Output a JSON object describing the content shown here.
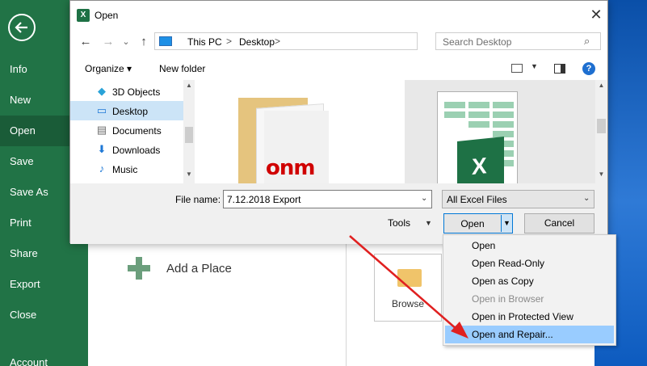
{
  "backstage": {
    "items": [
      {
        "label": "Info"
      },
      {
        "label": "New"
      },
      {
        "label": "Open"
      },
      {
        "label": "Save"
      },
      {
        "label": "Save As"
      },
      {
        "label": "Print"
      },
      {
        "label": "Share"
      },
      {
        "label": "Export"
      },
      {
        "label": "Close"
      },
      {
        "label": "Account"
      }
    ],
    "active": "Open",
    "colors": {
      "sidebar": "#217346",
      "active": "#1a5c38"
    }
  },
  "places": {
    "add_place_label": "Add a Place",
    "browse_label": "Browse"
  },
  "dialog": {
    "title": "Open",
    "close_glyph": "✕",
    "nav": {
      "back": "←",
      "forward": "→",
      "recent": "⌄",
      "up": "↑"
    },
    "address": {
      "segments": [
        "This PC",
        "Desktop"
      ],
      "separator": ">",
      "dropdown": "⌄",
      "refresh": "↻"
    },
    "search": {
      "placeholder": "Search Desktop",
      "icon": "⌕"
    },
    "toolbar": {
      "organize": "Organize ▾",
      "new_folder": "New folder",
      "view_dropdown": "▼",
      "help": "?"
    },
    "tree": [
      {
        "label": "3D Objects",
        "icon": "cube-icon",
        "glyph": "◆"
      },
      {
        "label": "Desktop",
        "icon": "desktop-icon",
        "glyph": "▭"
      },
      {
        "label": "Documents",
        "icon": "documents-icon",
        "glyph": "▤"
      },
      {
        "label": "Downloads",
        "icon": "download-icon",
        "glyph": "⬇"
      },
      {
        "label": "Music",
        "icon": "music-icon",
        "glyph": "♪"
      }
    ],
    "scroll": {
      "up": "▲",
      "down": "▼"
    },
    "files": {
      "folder_brand_text": "onm",
      "excel_badge_text": "X"
    },
    "file_name_label": "File name:",
    "file_name_value": "7.12.2018 Export",
    "filter_value": "All Excel Files",
    "combo_arrow": "⌄",
    "tools_label": "Tools",
    "tools_arrow": "▼",
    "open_label": "Open",
    "open_split_arrow": "▼",
    "cancel_label": "Cancel"
  },
  "open_menu": {
    "items": [
      {
        "label": "Open",
        "state": "enabled"
      },
      {
        "label": "Open Read-Only",
        "state": "enabled"
      },
      {
        "label": "Open as Copy",
        "state": "enabled"
      },
      {
        "label": "Open in Browser",
        "state": "disabled"
      },
      {
        "label": "Open in Protected View",
        "state": "enabled"
      },
      {
        "label": "Open and Repair...",
        "state": "highlighted"
      }
    ],
    "highlight_color": "#99ccff"
  },
  "annotation": {
    "arrow_color": "#e02020"
  }
}
